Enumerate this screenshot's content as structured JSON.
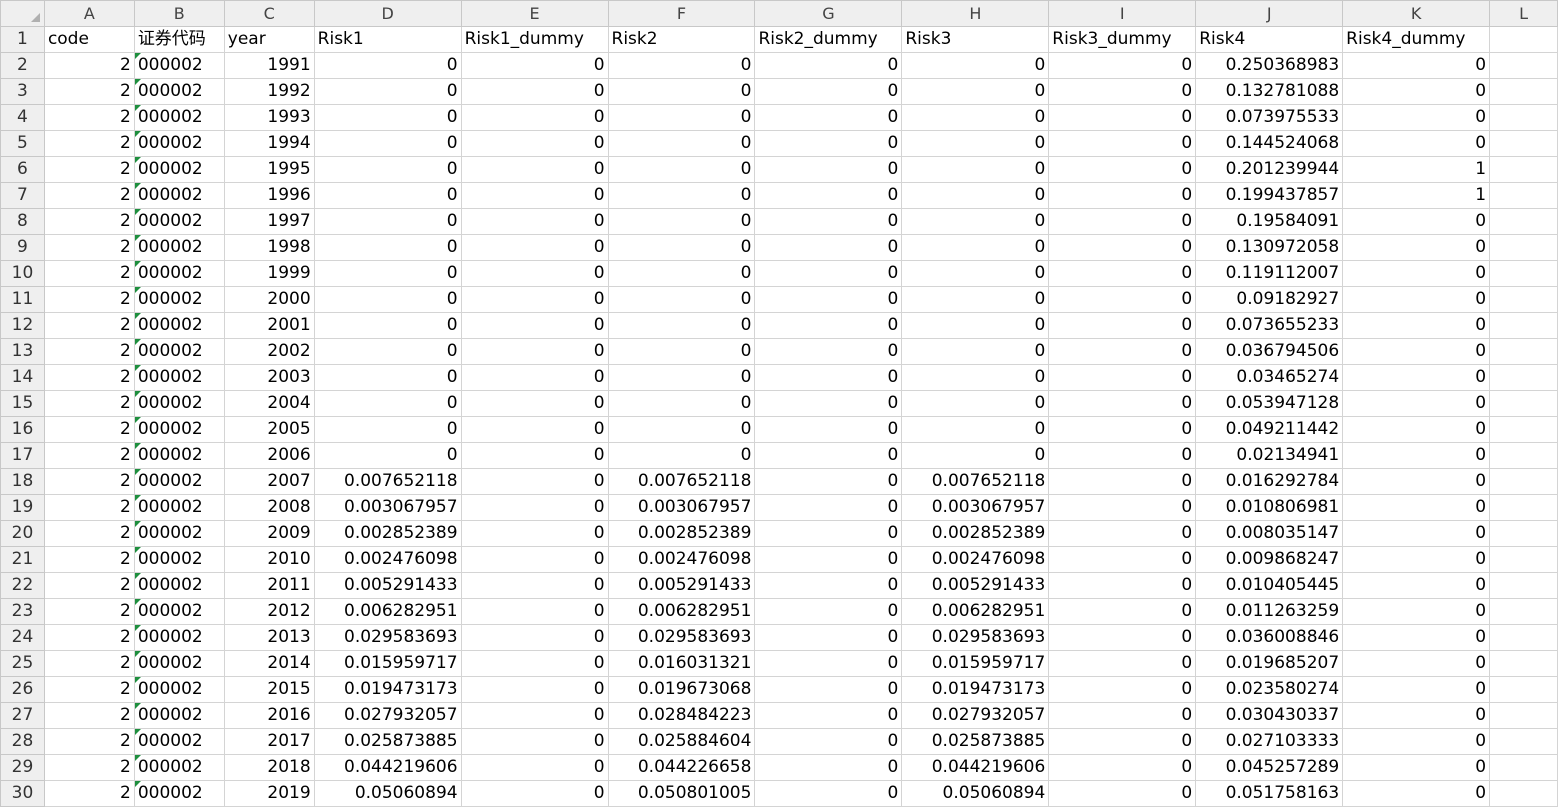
{
  "columns": [
    "A",
    "B",
    "C",
    "D",
    "E",
    "F",
    "G",
    "H",
    "I",
    "J",
    "K",
    "L"
  ],
  "headers": [
    "code",
    "证券代码",
    "year",
    "Risk1",
    "Risk1_dummy",
    "Risk2",
    "Risk2_dummy",
    "Risk3",
    "Risk3_dummy",
    "Risk4",
    "Risk4_dummy"
  ],
  "rows": [
    {
      "n": "2",
      "code": "2",
      "sec": "000002",
      "year": "1991",
      "r1": "0",
      "r1d": "0",
      "r2": "0",
      "r2d": "0",
      "r3": "0",
      "r3d": "0",
      "r4": "0.250368983",
      "r4d": "0"
    },
    {
      "n": "3",
      "code": "2",
      "sec": "000002",
      "year": "1992",
      "r1": "0",
      "r1d": "0",
      "r2": "0",
      "r2d": "0",
      "r3": "0",
      "r3d": "0",
      "r4": "0.132781088",
      "r4d": "0"
    },
    {
      "n": "4",
      "code": "2",
      "sec": "000002",
      "year": "1993",
      "r1": "0",
      "r1d": "0",
      "r2": "0",
      "r2d": "0",
      "r3": "0",
      "r3d": "0",
      "r4": "0.073975533",
      "r4d": "0"
    },
    {
      "n": "5",
      "code": "2",
      "sec": "000002",
      "year": "1994",
      "r1": "0",
      "r1d": "0",
      "r2": "0",
      "r2d": "0",
      "r3": "0",
      "r3d": "0",
      "r4": "0.144524068",
      "r4d": "0"
    },
    {
      "n": "6",
      "code": "2",
      "sec": "000002",
      "year": "1995",
      "r1": "0",
      "r1d": "0",
      "r2": "0",
      "r2d": "0",
      "r3": "0",
      "r3d": "0",
      "r4": "0.201239944",
      "r4d": "1"
    },
    {
      "n": "7",
      "code": "2",
      "sec": "000002",
      "year": "1996",
      "r1": "0",
      "r1d": "0",
      "r2": "0",
      "r2d": "0",
      "r3": "0",
      "r3d": "0",
      "r4": "0.199437857",
      "r4d": "1"
    },
    {
      "n": "8",
      "code": "2",
      "sec": "000002",
      "year": "1997",
      "r1": "0",
      "r1d": "0",
      "r2": "0",
      "r2d": "0",
      "r3": "0",
      "r3d": "0",
      "r4": "0.19584091",
      "r4d": "0"
    },
    {
      "n": "9",
      "code": "2",
      "sec": "000002",
      "year": "1998",
      "r1": "0",
      "r1d": "0",
      "r2": "0",
      "r2d": "0",
      "r3": "0",
      "r3d": "0",
      "r4": "0.130972058",
      "r4d": "0"
    },
    {
      "n": "10",
      "code": "2",
      "sec": "000002",
      "year": "1999",
      "r1": "0",
      "r1d": "0",
      "r2": "0",
      "r2d": "0",
      "r3": "0",
      "r3d": "0",
      "r4": "0.119112007",
      "r4d": "0"
    },
    {
      "n": "11",
      "code": "2",
      "sec": "000002",
      "year": "2000",
      "r1": "0",
      "r1d": "0",
      "r2": "0",
      "r2d": "0",
      "r3": "0",
      "r3d": "0",
      "r4": "0.09182927",
      "r4d": "0"
    },
    {
      "n": "12",
      "code": "2",
      "sec": "000002",
      "year": "2001",
      "r1": "0",
      "r1d": "0",
      "r2": "0",
      "r2d": "0",
      "r3": "0",
      "r3d": "0",
      "r4": "0.073655233",
      "r4d": "0"
    },
    {
      "n": "13",
      "code": "2",
      "sec": "000002",
      "year": "2002",
      "r1": "0",
      "r1d": "0",
      "r2": "0",
      "r2d": "0",
      "r3": "0",
      "r3d": "0",
      "r4": "0.036794506",
      "r4d": "0"
    },
    {
      "n": "14",
      "code": "2",
      "sec": "000002",
      "year": "2003",
      "r1": "0",
      "r1d": "0",
      "r2": "0",
      "r2d": "0",
      "r3": "0",
      "r3d": "0",
      "r4": "0.03465274",
      "r4d": "0"
    },
    {
      "n": "15",
      "code": "2",
      "sec": "000002",
      "year": "2004",
      "r1": "0",
      "r1d": "0",
      "r2": "0",
      "r2d": "0",
      "r3": "0",
      "r3d": "0",
      "r4": "0.053947128",
      "r4d": "0"
    },
    {
      "n": "16",
      "code": "2",
      "sec": "000002",
      "year": "2005",
      "r1": "0",
      "r1d": "0",
      "r2": "0",
      "r2d": "0",
      "r3": "0",
      "r3d": "0",
      "r4": "0.049211442",
      "r4d": "0"
    },
    {
      "n": "17",
      "code": "2",
      "sec": "000002",
      "year": "2006",
      "r1": "0",
      "r1d": "0",
      "r2": "0",
      "r2d": "0",
      "r3": "0",
      "r3d": "0",
      "r4": "0.02134941",
      "r4d": "0"
    },
    {
      "n": "18",
      "code": "2",
      "sec": "000002",
      "year": "2007",
      "r1": "0.007652118",
      "r1d": "0",
      "r2": "0.007652118",
      "r2d": "0",
      "r3": "0.007652118",
      "r3d": "0",
      "r4": "0.016292784",
      "r4d": "0"
    },
    {
      "n": "19",
      "code": "2",
      "sec": "000002",
      "year": "2008",
      "r1": "0.003067957",
      "r1d": "0",
      "r2": "0.003067957",
      "r2d": "0",
      "r3": "0.003067957",
      "r3d": "0",
      "r4": "0.010806981",
      "r4d": "0"
    },
    {
      "n": "20",
      "code": "2",
      "sec": "000002",
      "year": "2009",
      "r1": "0.002852389",
      "r1d": "0",
      "r2": "0.002852389",
      "r2d": "0",
      "r3": "0.002852389",
      "r3d": "0",
      "r4": "0.008035147",
      "r4d": "0"
    },
    {
      "n": "21",
      "code": "2",
      "sec": "000002",
      "year": "2010",
      "r1": "0.002476098",
      "r1d": "0",
      "r2": "0.002476098",
      "r2d": "0",
      "r3": "0.002476098",
      "r3d": "0",
      "r4": "0.009868247",
      "r4d": "0"
    },
    {
      "n": "22",
      "code": "2",
      "sec": "000002",
      "year": "2011",
      "r1": "0.005291433",
      "r1d": "0",
      "r2": "0.005291433",
      "r2d": "0",
      "r3": "0.005291433",
      "r3d": "0",
      "r4": "0.010405445",
      "r4d": "0"
    },
    {
      "n": "23",
      "code": "2",
      "sec": "000002",
      "year": "2012",
      "r1": "0.006282951",
      "r1d": "0",
      "r2": "0.006282951",
      "r2d": "0",
      "r3": "0.006282951",
      "r3d": "0",
      "r4": "0.011263259",
      "r4d": "0"
    },
    {
      "n": "24",
      "code": "2",
      "sec": "000002",
      "year": "2013",
      "r1": "0.029583693",
      "r1d": "0",
      "r2": "0.029583693",
      "r2d": "0",
      "r3": "0.029583693",
      "r3d": "0",
      "r4": "0.036008846",
      "r4d": "0"
    },
    {
      "n": "25",
      "code": "2",
      "sec": "000002",
      "year": "2014",
      "r1": "0.015959717",
      "r1d": "0",
      "r2": "0.016031321",
      "r2d": "0",
      "r3": "0.015959717",
      "r3d": "0",
      "r4": "0.019685207",
      "r4d": "0"
    },
    {
      "n": "26",
      "code": "2",
      "sec": "000002",
      "year": "2015",
      "r1": "0.019473173",
      "r1d": "0",
      "r2": "0.019673068",
      "r2d": "0",
      "r3": "0.019473173",
      "r3d": "0",
      "r4": "0.023580274",
      "r4d": "0"
    },
    {
      "n": "27",
      "code": "2",
      "sec": "000002",
      "year": "2016",
      "r1": "0.027932057",
      "r1d": "0",
      "r2": "0.028484223",
      "r2d": "0",
      "r3": "0.027932057",
      "r3d": "0",
      "r4": "0.030430337",
      "r4d": "0"
    },
    {
      "n": "28",
      "code": "2",
      "sec": "000002",
      "year": "2017",
      "r1": "0.025873885",
      "r1d": "0",
      "r2": "0.025884604",
      "r2d": "0",
      "r3": "0.025873885",
      "r3d": "0",
      "r4": "0.027103333",
      "r4d": "0"
    },
    {
      "n": "29",
      "code": "2",
      "sec": "000002",
      "year": "2018",
      "r1": "0.044219606",
      "r1d": "0",
      "r2": "0.044226658",
      "r2d": "0",
      "r3": "0.044219606",
      "r3d": "0",
      "r4": "0.045257289",
      "r4d": "0"
    },
    {
      "n": "30",
      "code": "2",
      "sec": "000002",
      "year": "2019",
      "r1": "0.05060894",
      "r1d": "0",
      "r2": "0.050801005",
      "r2d": "0",
      "r3": "0.05060894",
      "r3d": "0",
      "r4": "0.051758163",
      "r4d": "0"
    }
  ]
}
